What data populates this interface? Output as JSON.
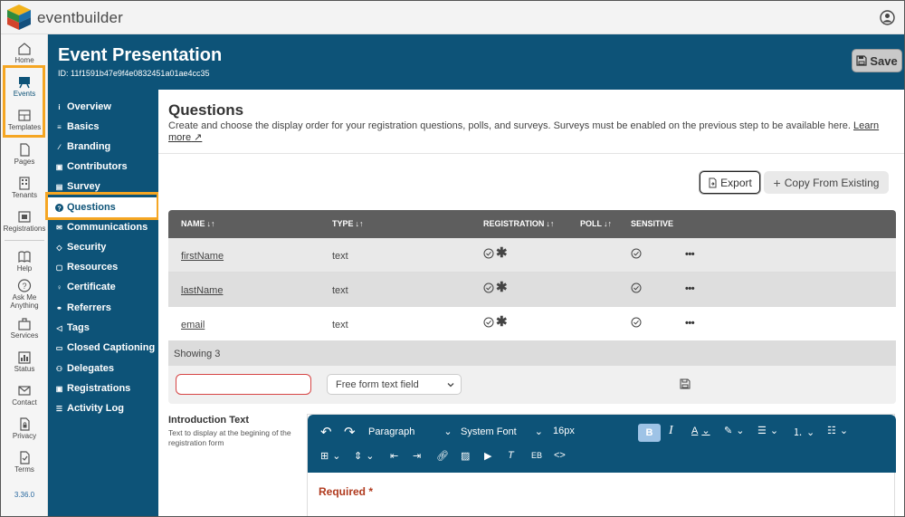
{
  "app": {
    "brand": "eventbuilder",
    "version": "3.36.0"
  },
  "rail": {
    "items": [
      {
        "label": "Home",
        "icon": "home-icon"
      },
      {
        "label": "Events",
        "icon": "events-icon",
        "active": true
      },
      {
        "label": "Templates",
        "icon": "templates-icon"
      },
      {
        "label": "Pages",
        "icon": "pages-icon"
      },
      {
        "label": "Tenants",
        "icon": "tenants-icon"
      },
      {
        "label": "Registrations",
        "icon": "registrations-icon"
      },
      {
        "label": "Help",
        "icon": "help-icon"
      },
      {
        "label": "Ask Me Anything",
        "icon": "ask-icon"
      },
      {
        "label": "Services",
        "icon": "services-icon"
      },
      {
        "label": "Status",
        "icon": "status-icon"
      },
      {
        "label": "Contact",
        "icon": "contact-icon"
      },
      {
        "label": "Privacy",
        "icon": "privacy-icon"
      },
      {
        "label": "Terms",
        "icon": "terms-icon"
      }
    ]
  },
  "header": {
    "title": "Event Presentation",
    "event_id": "ID: 11f1591b47e9f4e0832451a01ae4cc35",
    "save_label": "Save"
  },
  "nav": {
    "items": [
      {
        "label": "Overview",
        "icon": "info-icon"
      },
      {
        "label": "Basics",
        "icon": "basics-icon"
      },
      {
        "label": "Branding",
        "icon": "brush-icon"
      },
      {
        "label": "Contributors",
        "icon": "contributors-icon"
      },
      {
        "label": "Survey",
        "icon": "survey-icon"
      },
      {
        "label": "Questions",
        "icon": "question-icon",
        "active": true
      },
      {
        "label": "Communications",
        "icon": "mail-icon"
      },
      {
        "label": "Security",
        "icon": "shield-icon"
      },
      {
        "label": "Resources",
        "icon": "resources-icon"
      },
      {
        "label": "Certificate",
        "icon": "certificate-icon"
      },
      {
        "label": "Referrers",
        "icon": "referrers-icon"
      },
      {
        "label": "Tags",
        "icon": "tag-icon"
      },
      {
        "label": "Closed Captioning",
        "icon": "cc-icon"
      },
      {
        "label": "Delegates",
        "icon": "delegates-icon"
      },
      {
        "label": "Registrations",
        "icon": "registrations-icon"
      },
      {
        "label": "Activity Log",
        "icon": "list-icon"
      }
    ]
  },
  "questions": {
    "title": "Questions",
    "description": "Create and choose the display order for your registration questions, polls, and surveys. Surveys must be enabled on the previous step to be available here.",
    "learn_more": "Learn more",
    "export_label": "Export",
    "copy_label": "Copy From Existing",
    "columns": {
      "name": "NAME",
      "type": "TYPE",
      "registration": "REGISTRATION",
      "poll": "POLL",
      "sensitive": "SENSITIVE"
    },
    "rows": [
      {
        "name": "firstName",
        "type": "text",
        "registration": true,
        "required": true,
        "sensitive": true
      },
      {
        "name": "lastName",
        "type": "text",
        "registration": true,
        "required": true,
        "sensitive": true
      },
      {
        "name": "email",
        "type": "text",
        "registration": true,
        "required": true,
        "sensitive": true
      }
    ],
    "showing": "Showing 3",
    "new_name_value": "",
    "new_type_value": "Free form text field",
    "more_label": "•••"
  },
  "intro": {
    "label": "Introduction Text",
    "help": "Text to display at the begining of the registration form",
    "toolbar": {
      "block": "Paragraph",
      "font": "System Font",
      "size": "16px",
      "eb": "EB"
    },
    "content": "Required *"
  },
  "colors": {
    "brand": "#0d5378",
    "highlight": "#f5a623",
    "required": "#b03a1e"
  }
}
